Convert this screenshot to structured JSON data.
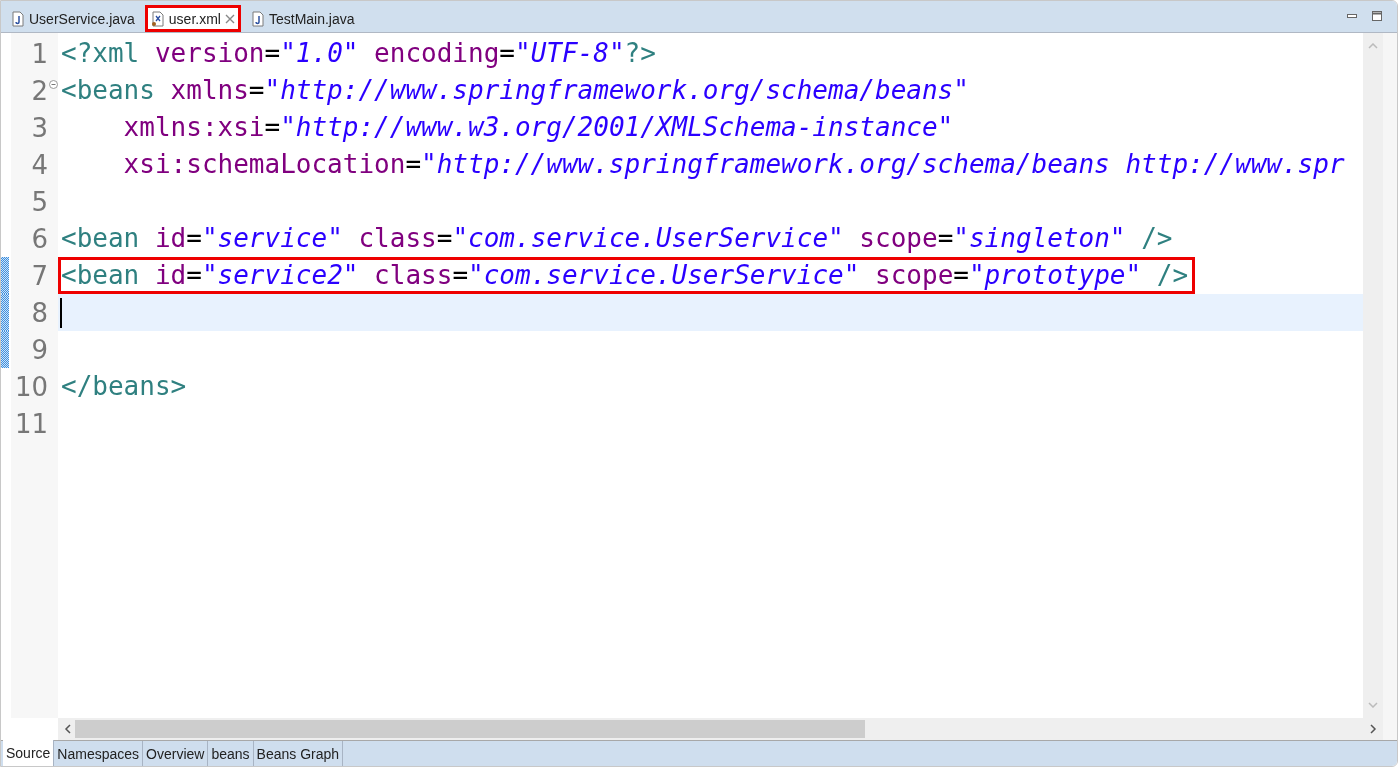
{
  "editor_tabs": [
    {
      "label": "UserService.java",
      "kind": "java",
      "selected": false
    },
    {
      "label": "user.xml",
      "kind": "xml",
      "selected": true,
      "highlighted": true,
      "closable": true
    },
    {
      "label": "TestMain.java",
      "kind": "java",
      "selected": false
    }
  ],
  "lines": [
    {
      "number": "1",
      "tokens": [
        {
          "kind": "tag",
          "text": "<?xml"
        },
        {
          "kind": "attr",
          "text": " version"
        },
        {
          "kind": "eq",
          "text": "="
        },
        {
          "kind": "value",
          "text": "\"1.0\""
        },
        {
          "kind": "attr",
          "text": " encoding"
        },
        {
          "kind": "eq",
          "text": "="
        },
        {
          "kind": "value",
          "text": "\"UTF-8\""
        },
        {
          "kind": "tag",
          "text": "?>"
        }
      ]
    },
    {
      "number": "2",
      "foldable": true,
      "tokens": [
        {
          "kind": "tag",
          "text": "<beans"
        },
        {
          "kind": "attr",
          "text": " xmlns"
        },
        {
          "kind": "eq",
          "text": "="
        },
        {
          "kind": "value",
          "text": "\"http://www.springframework.org/schema/beans\""
        }
      ]
    },
    {
      "number": "3",
      "tokens": [
        {
          "kind": "attr",
          "text": "    xmlns:xsi"
        },
        {
          "kind": "eq",
          "text": "="
        },
        {
          "kind": "value",
          "text": "\"http://www.w3.org/2001/XMLSchema-instance\""
        }
      ]
    },
    {
      "number": "4",
      "tokens": [
        {
          "kind": "attr",
          "text": "    xsi:schemaLocation"
        },
        {
          "kind": "eq",
          "text": "="
        },
        {
          "kind": "value",
          "text": "\"http://www.springframework.org/schema/beans http://www.spr"
        }
      ]
    },
    {
      "number": "5"
    },
    {
      "number": "6",
      "tokens": [
        {
          "kind": "tag",
          "text": "<bean"
        },
        {
          "kind": "attr",
          "text": " id"
        },
        {
          "kind": "eq",
          "text": "="
        },
        {
          "kind": "value",
          "text": "\"service\""
        },
        {
          "kind": "attr",
          "text": " class"
        },
        {
          "kind": "eq",
          "text": "="
        },
        {
          "kind": "value",
          "text": "\"com.service.UserService\""
        },
        {
          "kind": "attr",
          "text": " scope"
        },
        {
          "kind": "eq",
          "text": "="
        },
        {
          "kind": "value",
          "text": "\"singleton\""
        },
        {
          "kind": "tag",
          "text": " />"
        }
      ]
    },
    {
      "number": "7",
      "changed": true,
      "highlighted": true,
      "tokens": [
        {
          "kind": "tag",
          "text": "<bean"
        },
        {
          "kind": "attr",
          "text": " id"
        },
        {
          "kind": "eq",
          "text": "="
        },
        {
          "kind": "value",
          "text": "\"service2\""
        },
        {
          "kind": "attr",
          "text": " class"
        },
        {
          "kind": "eq",
          "text": "="
        },
        {
          "kind": "value",
          "text": "\"com.service.UserService\""
        },
        {
          "kind": "attr",
          "text": " scope"
        },
        {
          "kind": "eq",
          "text": "="
        },
        {
          "kind": "value",
          "text": "\"prototype\""
        },
        {
          "kind": "tag",
          "text": " />"
        }
      ]
    },
    {
      "number": "8",
      "current": true,
      "changed": true
    },
    {
      "number": "9",
      "changed": true
    },
    {
      "number": "10",
      "tokens": [
        {
          "kind": "tag",
          "text": "</beans>"
        }
      ]
    },
    {
      "number": "11"
    }
  ],
  "page_tabs": [
    {
      "label": "Source",
      "selected": true
    },
    {
      "label": "Namespaces",
      "selected": false
    },
    {
      "label": "Overview",
      "selected": false
    },
    {
      "label": "beans",
      "selected": false
    },
    {
      "label": "Beans Graph",
      "selected": false
    }
  ]
}
